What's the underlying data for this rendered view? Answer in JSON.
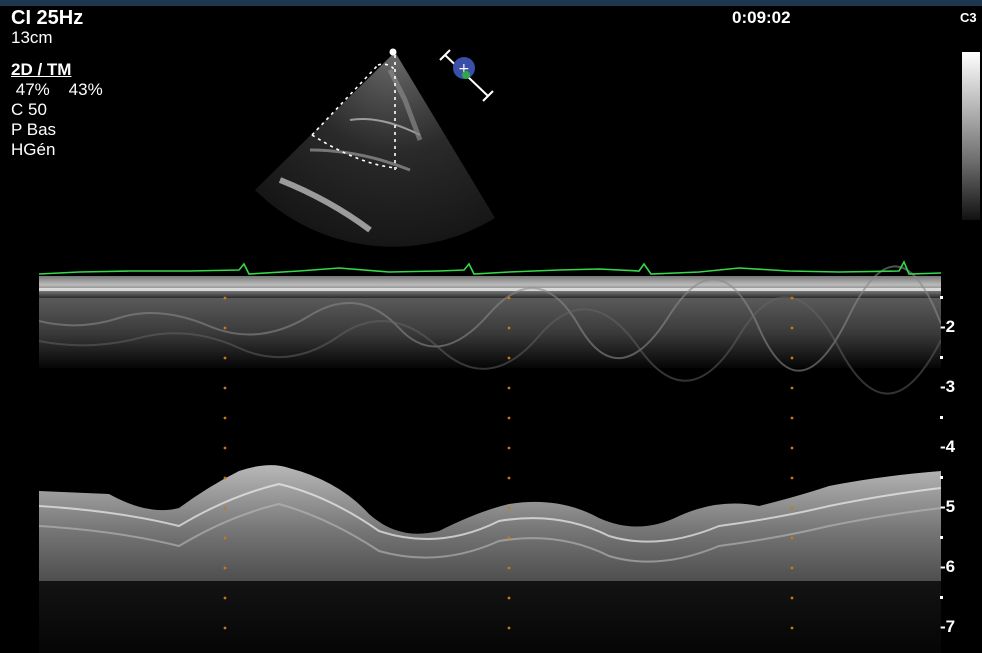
{
  "header": {
    "frame_rate": "CI 25Hz",
    "depth": "13cm",
    "mode": "2D / TM",
    "gain_2d": "47%",
    "gain_tm": "43%",
    "compression": "C 50",
    "persistence": "P Bas",
    "harmonics": "HGén",
    "clock": "0:09:02",
    "probe": "C3"
  },
  "depth_scale": {
    "ticks": [
      "-2",
      "-3",
      "-4",
      "-5",
      "-6",
      "-7"
    ]
  },
  "colors": {
    "ecg_trace": "#35d84a",
    "marker_dots": "#c9771c",
    "top_bar": "#1f3650"
  },
  "icons": [
    "orientation-marker-icon"
  ]
}
